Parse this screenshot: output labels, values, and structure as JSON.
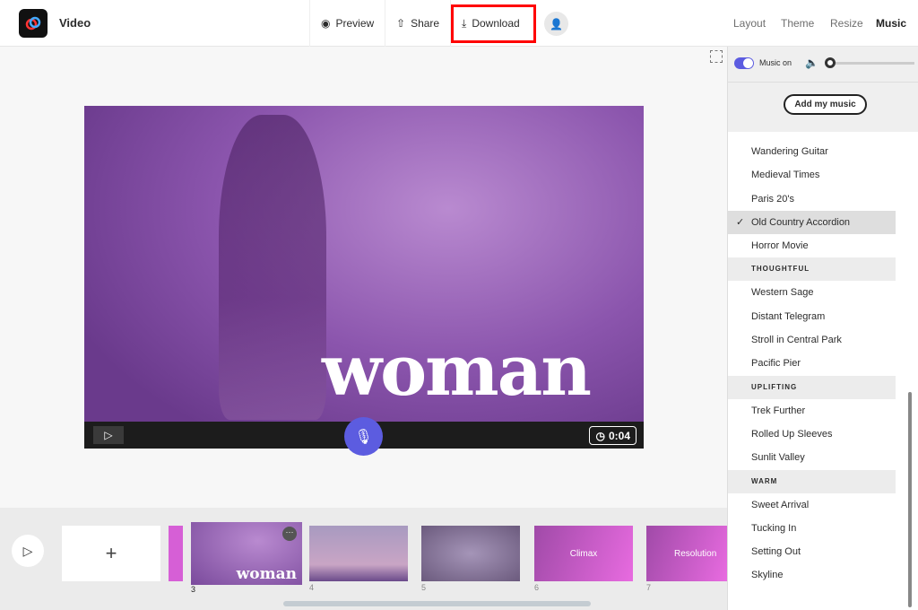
{
  "header": {
    "title": "Video",
    "preview": "Preview",
    "share": "Share",
    "download": "Download",
    "tabs": [
      "Layout",
      "Theme",
      "Resize",
      "Music"
    ]
  },
  "video": {
    "overlay_text": "woman",
    "duration": "0:04"
  },
  "music": {
    "toggle_label": "Music on",
    "add_button": "Add my music",
    "groups": [
      {
        "category": null,
        "tracks": [
          "Wandering Guitar",
          "Medieval Times",
          "Paris 20's",
          "Old Country Accordion",
          "Horror Movie"
        ]
      },
      {
        "category": "THOUGHTFUL",
        "tracks": [
          "Western Sage",
          "Distant Telegram",
          "Stroll in Central Park",
          "Pacific Pier"
        ]
      },
      {
        "category": "UPLIFTING",
        "tracks": [
          "Trek Further",
          "Rolled Up Sleeves",
          "Sunlit Valley"
        ]
      },
      {
        "category": "WARM",
        "tracks": [
          "Sweet Arrival",
          "Tucking In",
          "Setting Out",
          "Skyline"
        ]
      }
    ],
    "selected": "Old Country Accordion"
  },
  "filmstrip": {
    "add": "+",
    "slides": [
      {
        "num": "3",
        "label": "woman"
      },
      {
        "num": "4",
        "label": ""
      },
      {
        "num": "5",
        "label": ""
      },
      {
        "num": "6",
        "label": "Climax"
      },
      {
        "num": "7",
        "label": "Resolution"
      }
    ]
  },
  "colors": {
    "accent": "#5c5ce0",
    "highlight": "#ff0000"
  }
}
